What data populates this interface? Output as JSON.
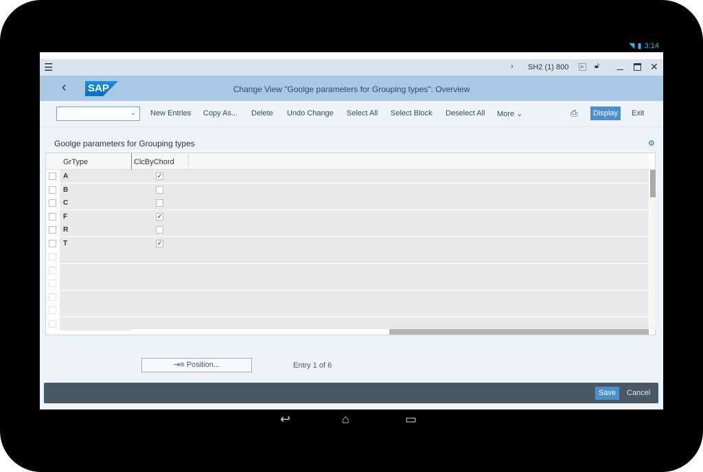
{
  "status": {
    "time": "3:14",
    "wifi_icon": "wifi-icon",
    "battery_icon": "battery-icon"
  },
  "titlebar": {
    "system": "SH2 (1) 800"
  },
  "header": {
    "title": "Change View \"Goolge parameters for Grouping types\": Overview",
    "logo": "SAP"
  },
  "toolbar": {
    "dropdown_value": "",
    "items": [
      "New Entries",
      "Copy As...",
      "Delete",
      "Undo Change",
      "Select All",
      "Select Block",
      "Deselect All",
      "More"
    ],
    "display": "Display",
    "exit": "Exit"
  },
  "section": {
    "title": "Goolge parameters for Grouping types"
  },
  "table": {
    "columns": [
      "GrType",
      "ClcByChord"
    ],
    "rows": [
      {
        "type": "A",
        "checked": true
      },
      {
        "type": "B",
        "checked": false
      },
      {
        "type": "C",
        "checked": false
      },
      {
        "type": "F",
        "checked": true
      },
      {
        "type": "R",
        "checked": false
      },
      {
        "type": "T",
        "checked": true
      }
    ],
    "empty_rows": 6
  },
  "position_button": "Position...",
  "entry_info": "Entry 1 of 6",
  "footer": {
    "save": "Save",
    "cancel": "Cancel"
  },
  "colors": {
    "accent": "#4a90d0",
    "header": "#a9c8e3",
    "footer": "#4a5966"
  }
}
